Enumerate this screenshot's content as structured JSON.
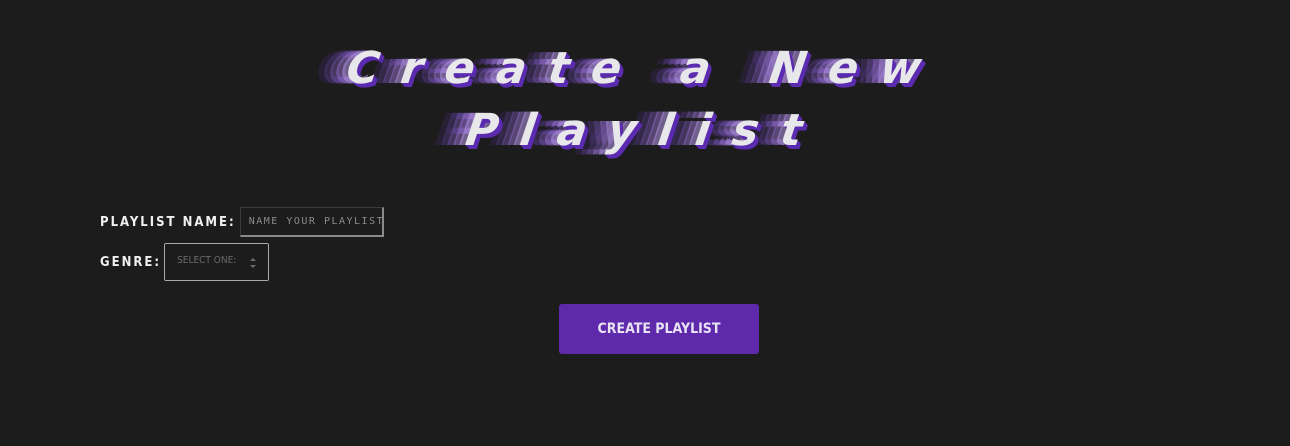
{
  "header": {
    "title_line1": "Create a New",
    "title_line2": "Playlist"
  },
  "form": {
    "name_label": "Playlist Name:",
    "name_placeholder": "Name your playlist",
    "genre_label": "Genre:",
    "genre_selected": "Select One:",
    "submit_label": "Create Playlist"
  },
  "icons": {
    "select_arrows": "up-down-chevron-icon"
  },
  "colors": {
    "background": "#1d1c1d",
    "accent": "#5e2aab",
    "title_shadow": "#5b2bb0"
  }
}
